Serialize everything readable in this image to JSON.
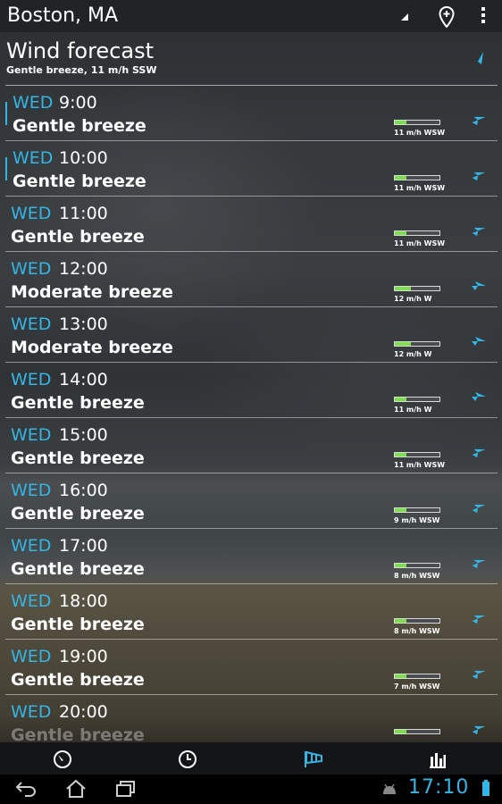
{
  "topbar": {
    "city": "Boston, MA"
  },
  "header": {
    "title": "Wind forecast",
    "subtitle": "Gentle breeze, 11 m/h SSW"
  },
  "forecast": [
    {
      "day": "WED",
      "time": "9:00",
      "desc": "Gentle breeze",
      "speed": "11 m/h WSW",
      "level": 0.25
    },
    {
      "day": "WED",
      "time": "10:00",
      "desc": "Gentle breeze",
      "speed": "11 m/h WSW",
      "level": 0.25
    },
    {
      "day": "WED",
      "time": "11:00",
      "desc": "Gentle breeze",
      "speed": "11 m/h WSW",
      "level": 0.25
    },
    {
      "day": "WED",
      "time": "12:00",
      "desc": "Moderate breeze",
      "speed": "12 m/h W",
      "level": 0.35
    },
    {
      "day": "WED",
      "time": "13:00",
      "desc": "Moderate breeze",
      "speed": "12 m/h W",
      "level": 0.35
    },
    {
      "day": "WED",
      "time": "14:00",
      "desc": "Gentle breeze",
      "speed": "11 m/h W",
      "level": 0.25
    },
    {
      "day": "WED",
      "time": "15:00",
      "desc": "Gentle breeze",
      "speed": "11 m/h WSW",
      "level": 0.25
    },
    {
      "day": "WED",
      "time": "16:00",
      "desc": "Gentle breeze",
      "speed": "9 m/h WSW",
      "level": 0.25
    },
    {
      "day": "WED",
      "time": "17:00",
      "desc": "Gentle breeze",
      "speed": "8 m/h WSW",
      "level": 0.25
    },
    {
      "day": "WED",
      "time": "18:00",
      "desc": "Gentle breeze",
      "speed": "8 m/h WSW",
      "level": 0.25
    },
    {
      "day": "WED",
      "time": "19:00",
      "desc": "Gentle breeze",
      "speed": "7 m/h WSW",
      "level": 0.25
    },
    {
      "day": "WED",
      "time": "20:00",
      "desc": "Gentle breeze",
      "speed": "",
      "level": 0.25
    }
  ],
  "system": {
    "clock": "17:10"
  },
  "colors": {
    "accent": "#33b5e5",
    "bar_fill": "#7be04a"
  }
}
